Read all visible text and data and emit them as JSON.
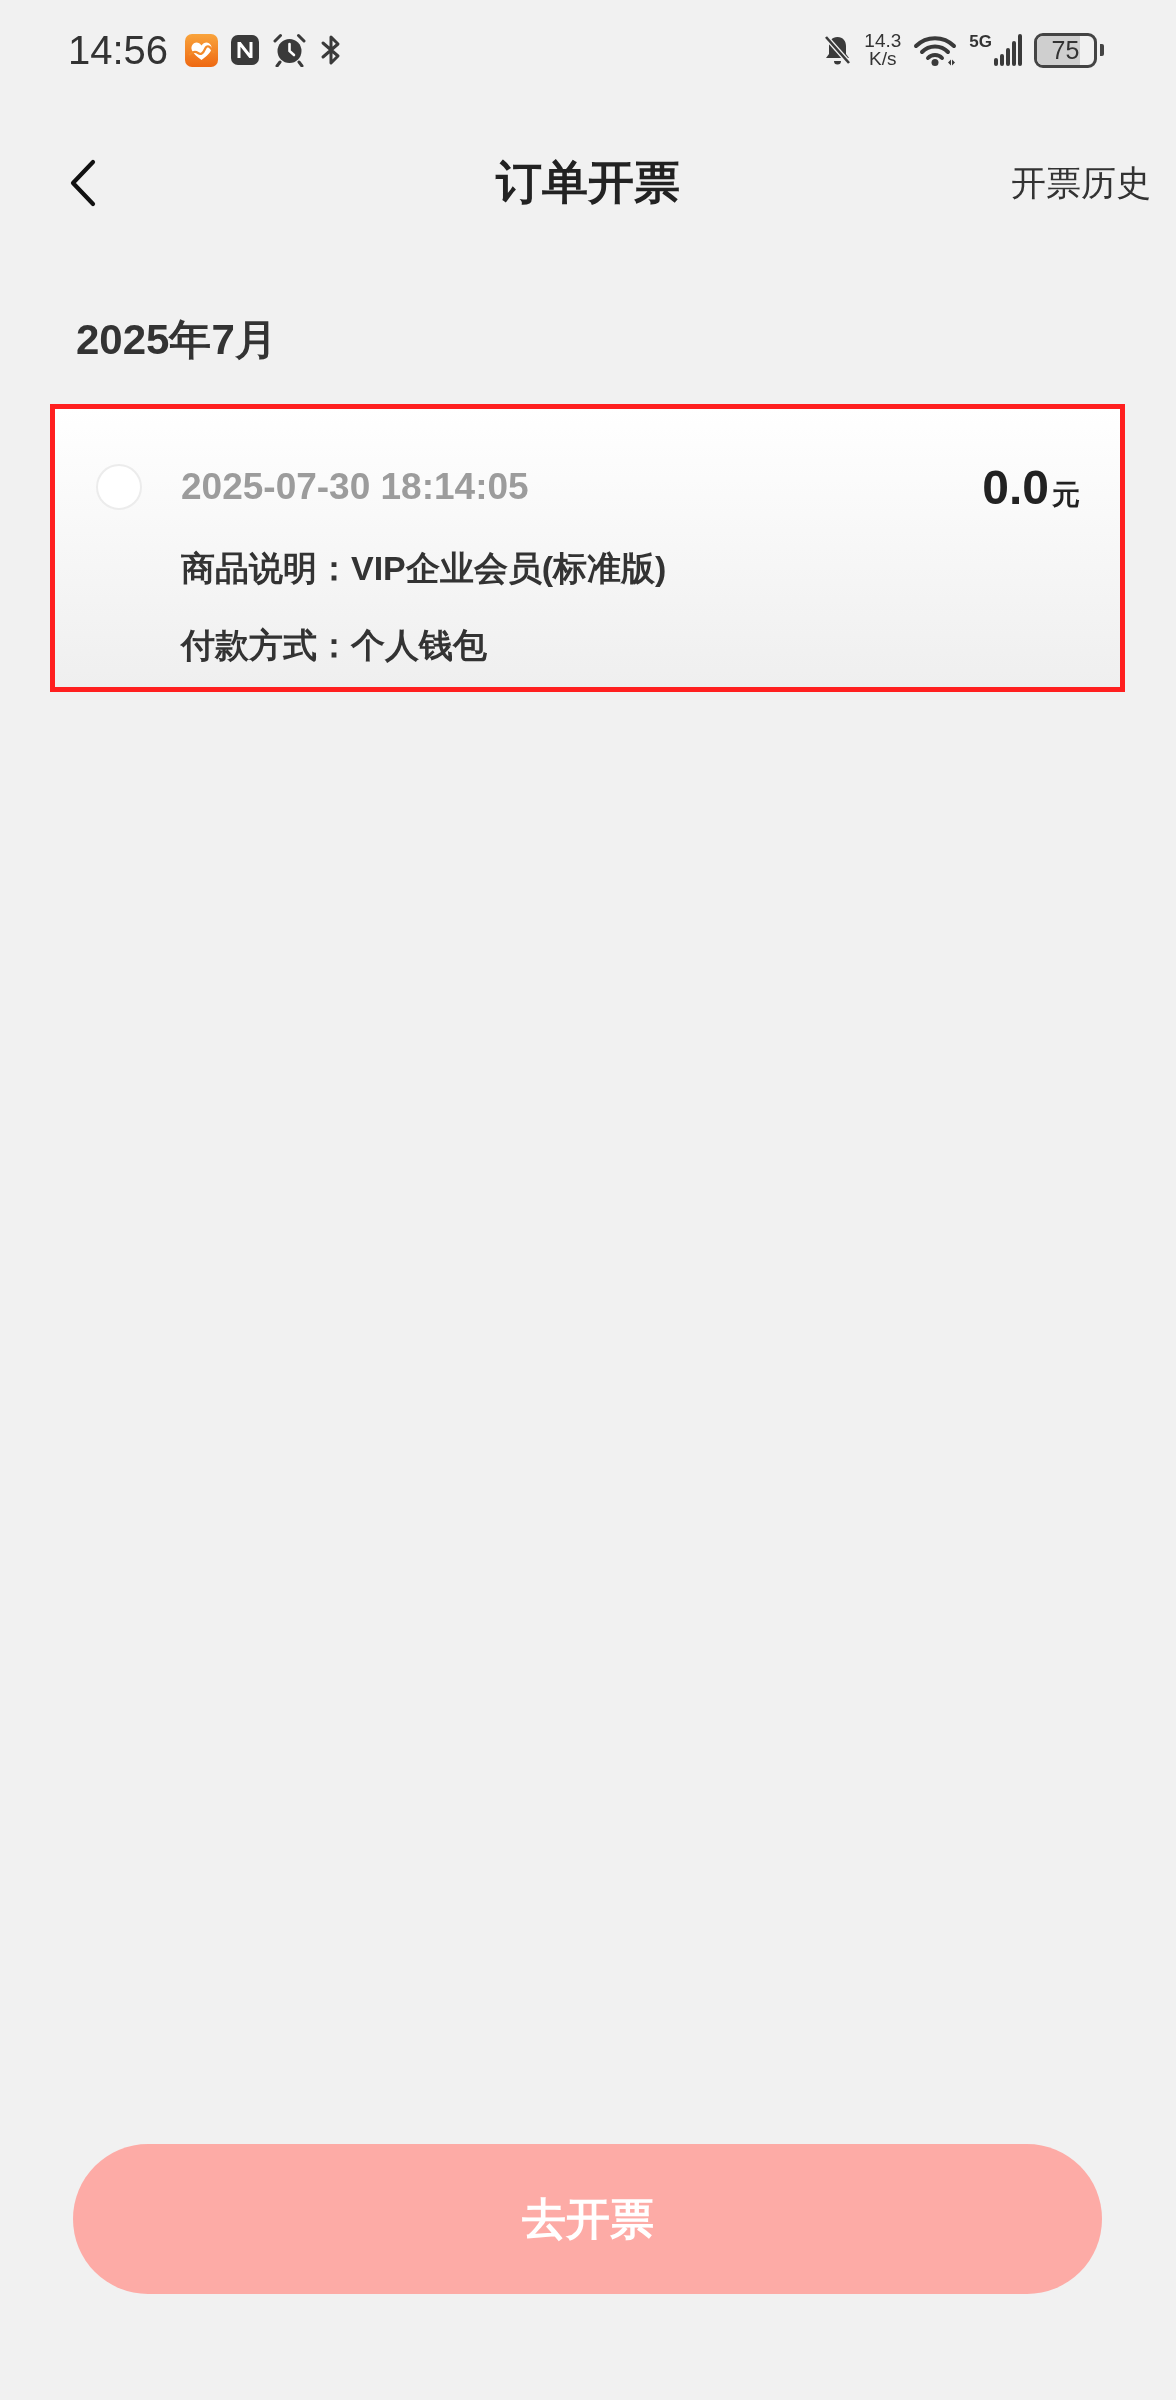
{
  "status_bar": {
    "time": "14:56",
    "speed_value": "14.3",
    "speed_unit": "K/s",
    "network_type": "5G",
    "battery": "75"
  },
  "header": {
    "title": "订单开票",
    "action": "开票历史"
  },
  "sections": [
    {
      "month": "2025年7月",
      "orders": [
        {
          "selected": false,
          "highlighted": true,
          "datetime": "2025-07-30 18:14:05",
          "amount": "0.0",
          "currency": "元",
          "details": [
            {
              "label": "商品说明：",
              "value": "VIP企业会员(标准版)"
            },
            {
              "label": "付款方式：",
              "value": "个人钱包"
            }
          ]
        }
      ]
    }
  ],
  "submit_button": {
    "label": "去开票",
    "disabled": true
  }
}
